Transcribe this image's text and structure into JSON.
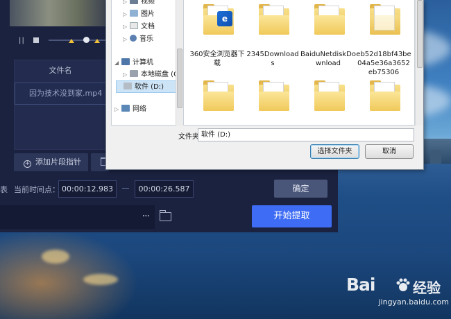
{
  "background": {
    "sky_color": "#3f7fc0",
    "water_color": "#1f4e86"
  },
  "editor": {
    "file_list": {
      "header": "文件名",
      "rows": [
        "因为技术没到家.mp4"
      ]
    },
    "add_marker_label": "添加片段指针",
    "time": {
      "label_fragment": "表",
      "current_label": "当前时间点：",
      "start": "00:00:12.983",
      "end": "00:00:26.587"
    },
    "confirm_label": "确定",
    "output": {
      "browse_dots": "···"
    },
    "extract_label": "开始提取",
    "accent_color": "#3e6cf4"
  },
  "dialog": {
    "nav": {
      "items": [
        {
          "label": "视频",
          "icon": "video-library-icon"
        },
        {
          "label": "图片",
          "icon": "picture-library-icon"
        },
        {
          "label": "文档",
          "icon": "document-library-icon"
        },
        {
          "label": "音乐",
          "icon": "music-library-icon"
        },
        {
          "label": "计算机",
          "icon": "computer-icon"
        },
        {
          "label": "本地磁盘 (C:)",
          "icon": "drive-icon"
        },
        {
          "label": "软件 (D:)",
          "icon": "drive-icon"
        },
        {
          "label": "网络",
          "icon": "network-icon"
        }
      ]
    },
    "folders": [
      {
        "label": "360安全浏览器下载"
      },
      {
        "label": "2345Downloads"
      },
      {
        "label": "BaiduNetdiskDownload"
      },
      {
        "label": "eb52d18bf43be04a5e36a3652eb75306"
      },
      {
        "label": ""
      },
      {
        "label": ""
      },
      {
        "label": ""
      },
      {
        "label": ""
      }
    ],
    "filename_label": "文件夹:",
    "filename_value": "软件 (D:)",
    "select_label": "选择文件夹",
    "cancel_label": "取消"
  },
  "watermark": {
    "brand": "Bai",
    "brand2": "经验",
    "url": "jingyan.baidu.com"
  }
}
